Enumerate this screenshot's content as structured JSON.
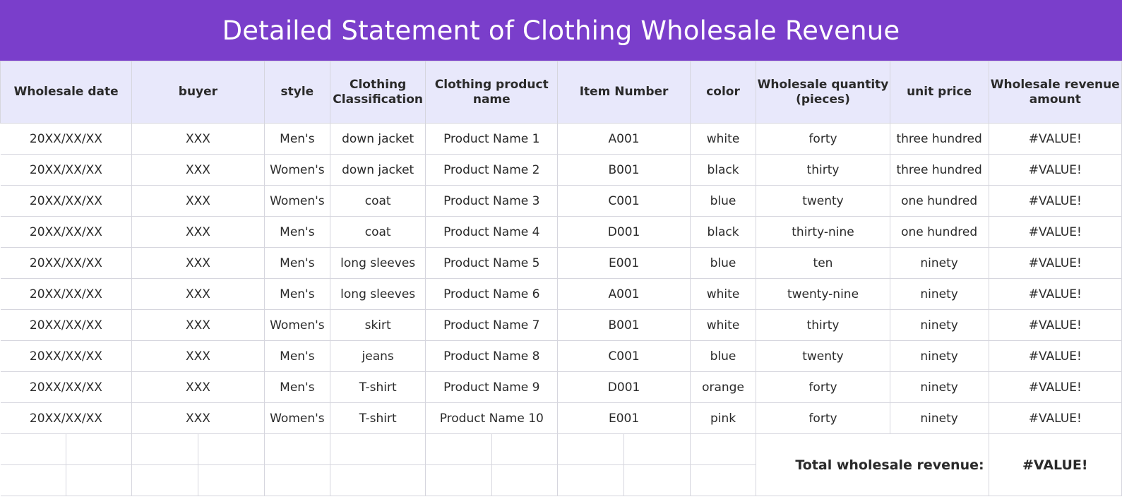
{
  "title": "Detailed Statement of Clothing Wholesale Revenue",
  "columns": [
    "Wholesale date",
    "buyer",
    "style",
    "Clothing Classification",
    "Clothing product name",
    "Item Number",
    "color",
    "Wholesale quantity (pieces)",
    "unit price",
    "Wholesale revenue amount"
  ],
  "rows": [
    [
      "20XX/XX/XX",
      "XXX",
      "Men's",
      "down jacket",
      "Product Name 1",
      "A001",
      "white",
      "forty",
      "three hundred",
      "#VALUE!"
    ],
    [
      "20XX/XX/XX",
      "XXX",
      "Women's",
      "down jacket",
      "Product Name 2",
      "B001",
      "black",
      "thirty",
      "three hundred",
      "#VALUE!"
    ],
    [
      "20XX/XX/XX",
      "XXX",
      "Women's",
      "coat",
      "Product Name 3",
      "C001",
      "blue",
      "twenty",
      "one hundred",
      "#VALUE!"
    ],
    [
      "20XX/XX/XX",
      "XXX",
      "Men's",
      "coat",
      "Product Name 4",
      "D001",
      "black",
      "thirty-nine",
      "one hundred",
      "#VALUE!"
    ],
    [
      "20XX/XX/XX",
      "XXX",
      "Men's",
      "long sleeves",
      "Product Name 5",
      "E001",
      "blue",
      "ten",
      "ninety",
      "#VALUE!"
    ],
    [
      "20XX/XX/XX",
      "XXX",
      "Men's",
      "long sleeves",
      "Product Name 6",
      "A001",
      "white",
      "twenty-nine",
      "ninety",
      "#VALUE!"
    ],
    [
      "20XX/XX/XX",
      "XXX",
      "Women's",
      "skirt",
      "Product Name 7",
      "B001",
      "white",
      "thirty",
      "ninety",
      "#VALUE!"
    ],
    [
      "20XX/XX/XX",
      "XXX",
      "Men's",
      "jeans",
      "Product Name 8",
      "C001",
      "blue",
      "twenty",
      "ninety",
      "#VALUE!"
    ],
    [
      "20XX/XX/XX",
      "XXX",
      "Men's",
      "T-shirt",
      "Product Name 9",
      "D001",
      "orange",
      "forty",
      "ninety",
      "#VALUE!"
    ],
    [
      "20XX/XX/XX",
      "XXX",
      "Women's",
      "T-shirt",
      "Product Name 10",
      "E001",
      "pink",
      "forty",
      "ninety",
      "#VALUE!"
    ]
  ],
  "total": {
    "label": "Total wholesale revenue:",
    "value": "#VALUE!"
  },
  "colors": {
    "banner": "#7a3ecb",
    "header_fill": "#e8e8fb",
    "grid": "#d6d6de"
  }
}
